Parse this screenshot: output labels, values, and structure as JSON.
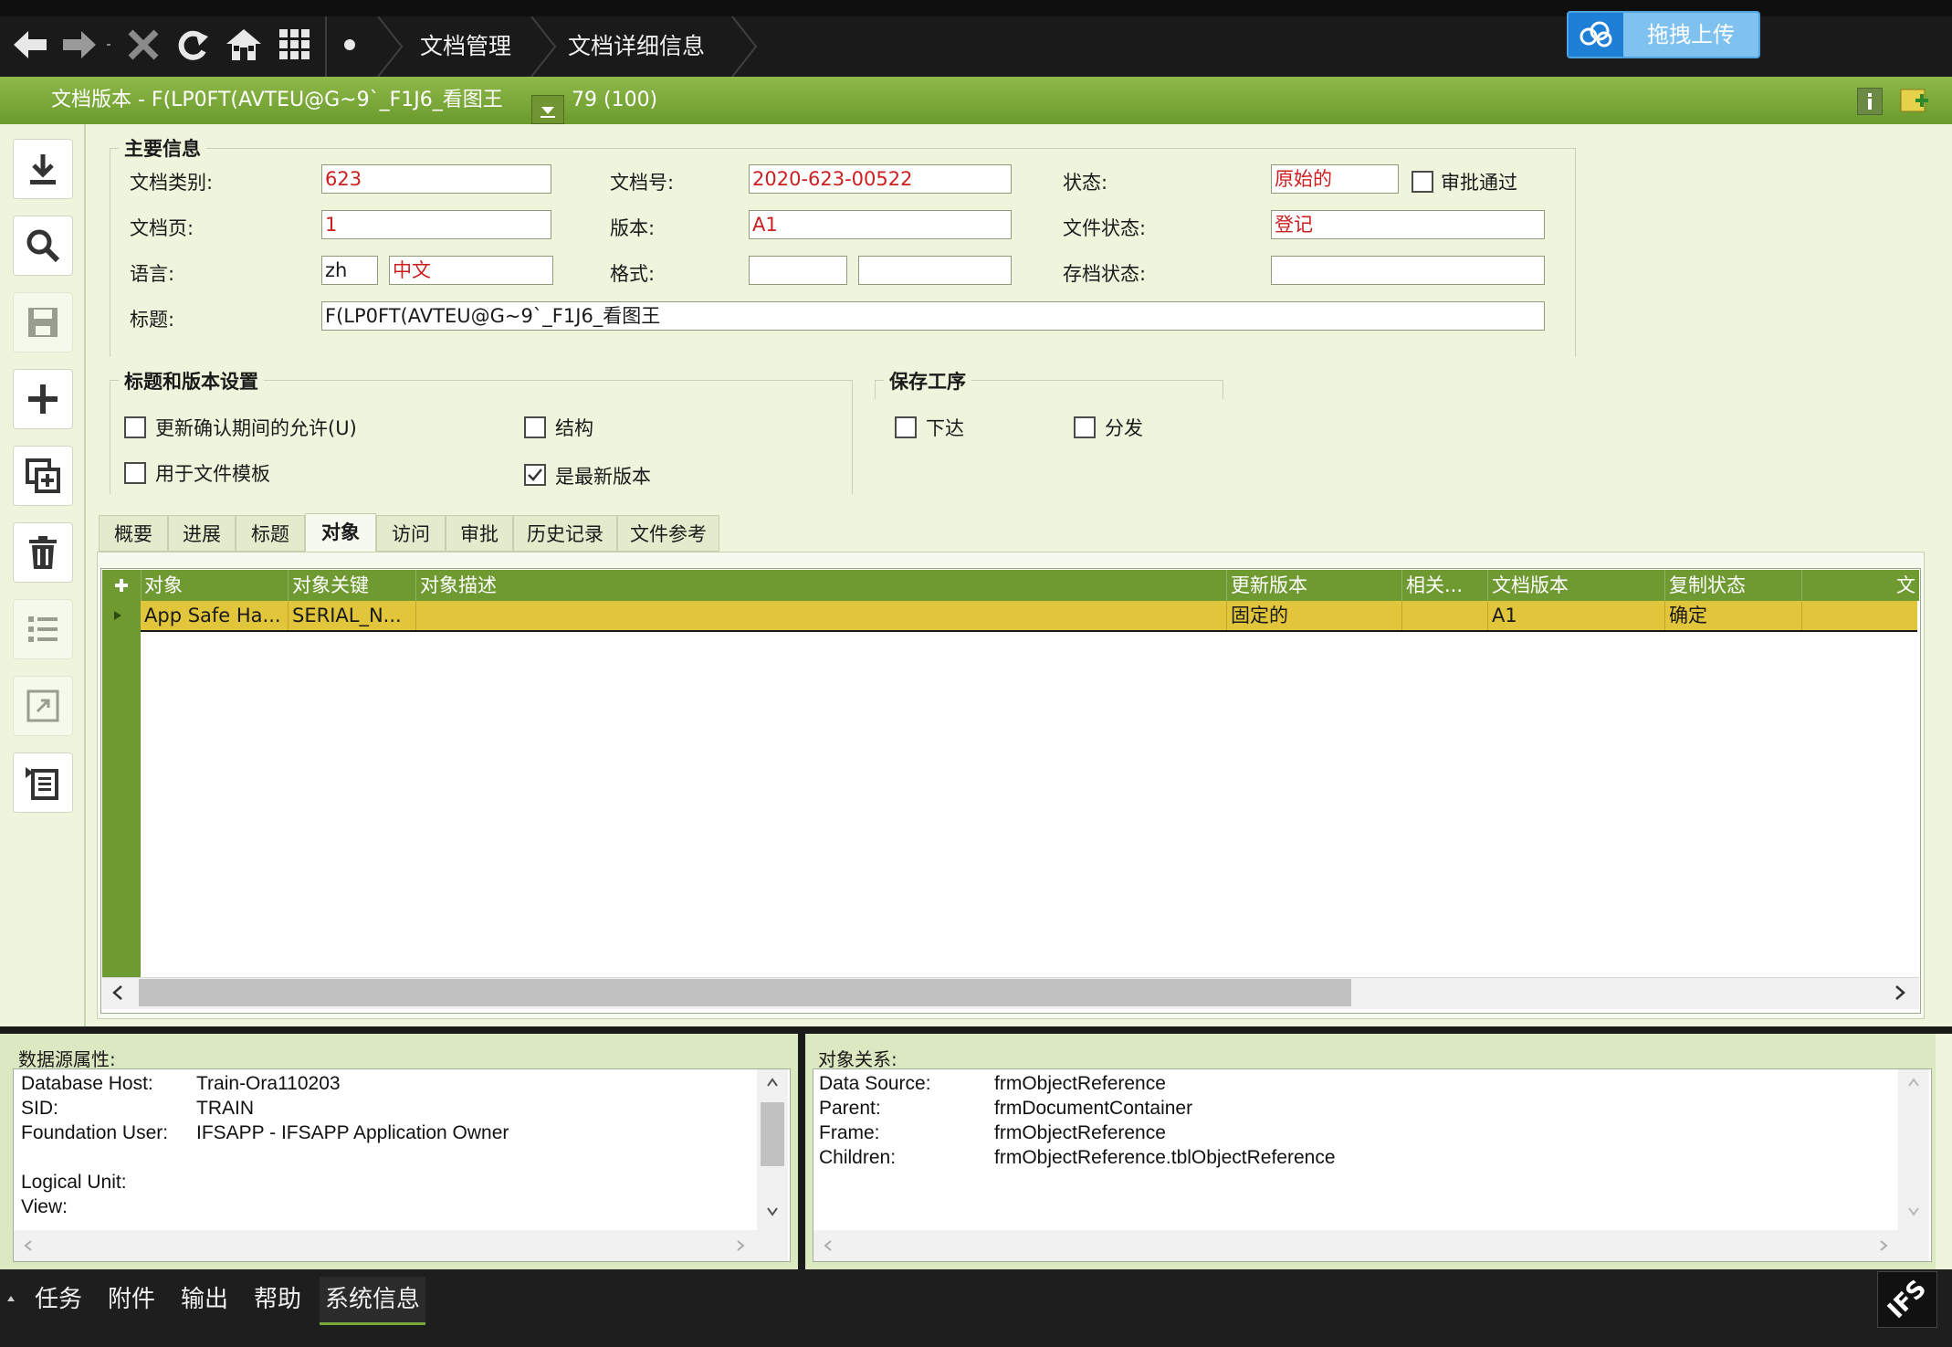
{
  "nav": {
    "breadcrumbs": [
      "文档管理",
      "文档详细信息"
    ],
    "upload_label": "拖拽上传"
  },
  "titlebar": {
    "title": "文档版本 - F(LP0FT(AVTEU@G~9`_F1J6_看图王",
    "count": "79 (100)"
  },
  "main_info": {
    "heading": "主要信息",
    "doc_class_label": "文档类别:",
    "doc_class_value": "623",
    "doc_no_label": "文档号:",
    "doc_no_value": "2020-623-00522",
    "status_label": "状态:",
    "status_value": "原始的",
    "approved_label": "审批通过",
    "doc_sheet_label": "文档页:",
    "doc_sheet_value": "1",
    "revision_label": "版本:",
    "revision_value": "A1",
    "file_status_label": "文件状态:",
    "file_status_value": "登记",
    "language_label": "语言:",
    "language_code": "zh",
    "language_name": "中文",
    "format_label": "格式:",
    "format_value1": "",
    "format_value2": "",
    "archive_status_label": "存档状态:",
    "archive_status_value": "",
    "title_label": "标题:",
    "title_value": "F(LP0FT(AVTEU@G~9`_F1J6_看图王"
  },
  "title_rev_settings": {
    "heading": "标题和版本设置",
    "update_allowed": "更新确认期间的允许(U)",
    "structure": "结构",
    "for_template": "用于文件模板",
    "latest_revision": "是最新版本"
  },
  "save_procedure": {
    "heading": "保存工序",
    "release": "下达",
    "distribute": "分发"
  },
  "tabs": [
    "概要",
    "进展",
    "标题",
    "对象",
    "访问",
    "审批",
    "历史记录",
    "文件参考"
  ],
  "grid": {
    "columns": [
      "对象",
      "对象关键",
      "对象描述",
      "更新版本",
      "相关...",
      "文档版本",
      "复制状态",
      "文"
    ],
    "rows": [
      [
        "App Safe Ha...",
        "SERIAL_N...",
        "",
        "固定的",
        "",
        "A1",
        "确定",
        ""
      ]
    ]
  },
  "datasource_pane": {
    "heading": "数据源属性:",
    "rows": [
      {
        "key": "Database Host:",
        "value": "Train-Ora110203"
      },
      {
        "key": "SID:",
        "value": "TRAIN"
      },
      {
        "key": "Foundation User:",
        "value": "IFSAPP - IFSAPP Application Owner"
      },
      {
        "key": "",
        "value": ""
      },
      {
        "key": "Logical Unit:",
        "value": ""
      },
      {
        "key": "View:",
        "value": ""
      }
    ]
  },
  "relation_pane": {
    "heading": "对象关系:",
    "rows": [
      {
        "key": "Data Source:",
        "value": "frmObjectReference"
      },
      {
        "key": "Parent:",
        "value": "frmDocumentContainer"
      },
      {
        "key": "Frame:",
        "value": "frmObjectReference"
      },
      {
        "key": "Children:",
        "value": "frmObjectReference.tblObjectReference"
      }
    ]
  },
  "taskbar": [
    "任务",
    "附件",
    "输出",
    "帮助",
    "系统信息"
  ],
  "brand": "IFS",
  "colors": {
    "titlebar_green": "#7aa83a",
    "grid_header_green": "#6f9a32",
    "selected_row": "#e1c63b",
    "required_text": "#cc1f1f"
  }
}
